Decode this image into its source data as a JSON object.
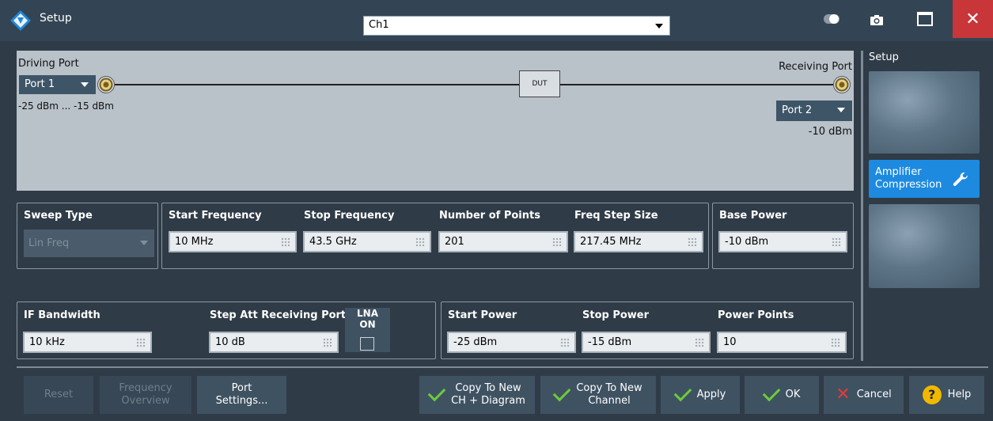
{
  "window": {
    "title": "Setup",
    "channel_select": "Ch1",
    "close_label": "✕"
  },
  "diagram": {
    "driving_port_label": "Driving Port",
    "driving_port_select": "Port 1",
    "driving_power_range": "-25 dBm ... -15 dBm",
    "dut_label": "DUT",
    "receiving_port_label": "Receiving Port",
    "receiving_port_select": "Port 2",
    "receiving_power": "-10 dBm"
  },
  "right_panel": {
    "title": "Setup",
    "active_tile": "Amplifier Compression"
  },
  "sweep": {
    "sweep_type_label": "Sweep Type",
    "sweep_type_value": "Lin Freq",
    "start_freq_label": "Start Frequency",
    "start_freq_value": "10 MHz",
    "stop_freq_label": "Stop Frequency",
    "stop_freq_value": "43.5 GHz",
    "num_points_label": "Number of Points",
    "num_points_value": "201",
    "freq_step_label": "Freq Step Size",
    "freq_step_value": "217.45 MHz",
    "base_power_label": "Base Power",
    "base_power_value": "-10 dBm"
  },
  "receiver": {
    "if_bw_label": "IF Bandwidth",
    "if_bw_value": "10 kHz",
    "step_att_label": "Step Att Receiving Port",
    "step_att_value": "10 dB",
    "lna_label": "LNA",
    "lna_state": "ON",
    "lna_checked": false
  },
  "power_sweep": {
    "start_power_label": "Start Power",
    "start_power_value": "-25 dBm",
    "stop_power_label": "Stop Power",
    "stop_power_value": "-15 dBm",
    "power_points_label": "Power Points",
    "power_points_value": "10"
  },
  "buttons": {
    "reset": "Reset",
    "freq_overview_1": "Frequency",
    "freq_overview_2": "Overview",
    "port_settings_1": "Port",
    "port_settings_2": "Settings...",
    "copy_ch_diag_1": "Copy To New",
    "copy_ch_diag_2": "CH + Diagram",
    "copy_channel_1": "Copy To New",
    "copy_channel_2": "Channel",
    "apply": "Apply",
    "ok": "OK",
    "cancel": "Cancel",
    "help": "Help"
  },
  "colors": {
    "background": "#2f3b47",
    "accent": "#1d8ae0",
    "close": "#c8363a",
    "check": "#6ccb3c"
  }
}
